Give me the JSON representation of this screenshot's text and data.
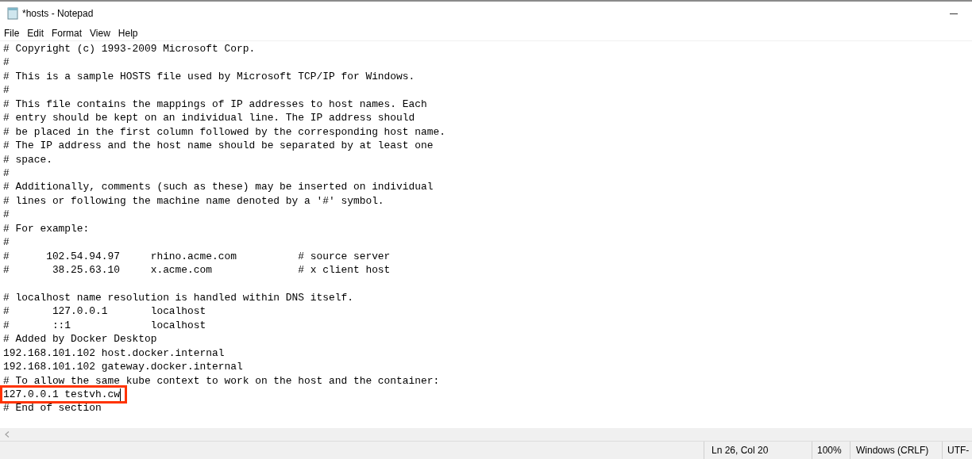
{
  "window": {
    "title": "*hosts - Notepad"
  },
  "menu": [
    "File",
    "Edit",
    "Format",
    "View",
    "Help"
  ],
  "lines": [
    {
      "kind": "text",
      "text": "# Copyright (c) 1993-2009 Microsoft Corp.",
      "highlighted": false
    },
    {
      "kind": "text",
      "text": "#",
      "highlighted": false
    },
    {
      "kind": "text",
      "text": "# This is a sample HOSTS file used by Microsoft TCP/IP for Windows.",
      "highlighted": false
    },
    {
      "kind": "text",
      "text": "#",
      "highlighted": false
    },
    {
      "kind": "text",
      "text": "# This file contains the mappings of IP addresses to host names. Each",
      "highlighted": false
    },
    {
      "kind": "text",
      "text": "# entry should be kept on an individual line. The IP address should",
      "highlighted": false
    },
    {
      "kind": "text",
      "text": "# be placed in the first column followed by the corresponding host name.",
      "highlighted": false
    },
    {
      "kind": "text",
      "text": "# The IP address and the host name should be separated by at least one",
      "highlighted": false
    },
    {
      "kind": "text",
      "text": "# space.",
      "highlighted": false
    },
    {
      "kind": "text",
      "text": "#",
      "highlighted": false
    },
    {
      "kind": "text",
      "text": "# Additionally, comments (such as these) may be inserted on individual",
      "highlighted": false
    },
    {
      "kind": "text",
      "text": "# lines or following the machine name denoted by a '#' symbol.",
      "highlighted": false
    },
    {
      "kind": "text",
      "text": "#",
      "highlighted": false
    },
    {
      "kind": "text",
      "text": "# For example:",
      "highlighted": false
    },
    {
      "kind": "text",
      "text": "#",
      "highlighted": false
    },
    {
      "kind": "text",
      "text": "#      102.54.94.97     rhino.acme.com          # source server",
      "highlighted": false
    },
    {
      "kind": "text",
      "text": "#       38.25.63.10     x.acme.com              # x client host",
      "highlighted": false
    },
    {
      "kind": "blank"
    },
    {
      "kind": "text",
      "text": "# localhost name resolution is handled within DNS itself.",
      "highlighted": false
    },
    {
      "kind": "text",
      "text": "#       127.0.0.1       localhost",
      "highlighted": false
    },
    {
      "kind": "text",
      "text": "#       ::1             localhost",
      "highlighted": false
    },
    {
      "kind": "text",
      "text": "# Added by Docker Desktop",
      "highlighted": false
    },
    {
      "kind": "text",
      "text": "192.168.101.102 host.docker.internal",
      "highlighted": false
    },
    {
      "kind": "text",
      "text": "192.168.101.102 gateway.docker.internal",
      "highlighted": false
    },
    {
      "kind": "text",
      "text": "# To allow the same kube context to work on the host and the container:",
      "highlighted": false
    },
    {
      "kind": "text",
      "text": "127.0.0.1 testvh.cw",
      "highlighted": true,
      "cursor": true
    },
    {
      "kind": "text",
      "text": "# End of section",
      "highlighted": false
    }
  ],
  "status_bar": [
    "Ln 26, Col 20",
    "100%",
    "Windows (CRLF)",
    "UTF-"
  ]
}
